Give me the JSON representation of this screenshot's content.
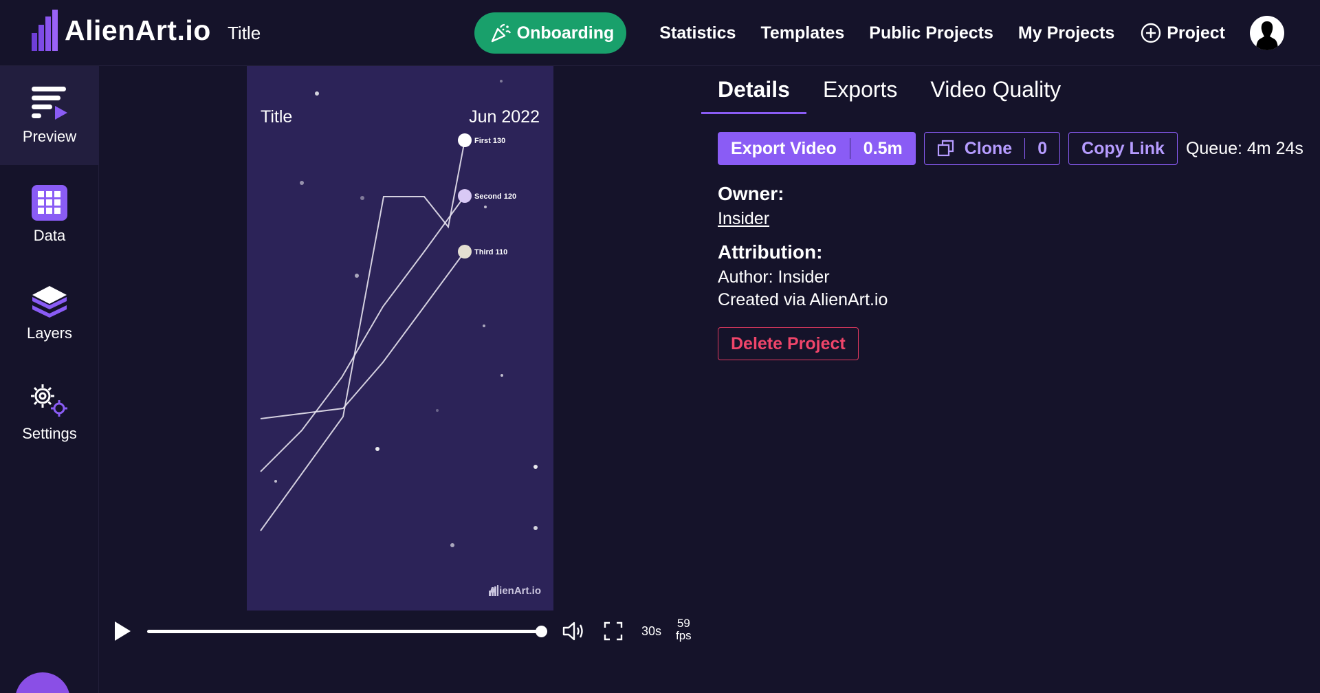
{
  "header": {
    "brand": "AlienArt.io",
    "project_title": "Title",
    "nav": {
      "onboarding": "Onboarding",
      "statistics": "Statistics",
      "templates": "Templates",
      "public_projects": "Public Projects",
      "my_projects": "My Projects",
      "new_project": "Project"
    }
  },
  "sidebar": {
    "items": [
      {
        "label": "Preview",
        "icon": "preview-icon"
      },
      {
        "label": "Data",
        "icon": "grid-icon"
      },
      {
        "label": "Layers",
        "icon": "layers-icon"
      },
      {
        "label": "Settings",
        "icon": "gears-icon"
      }
    ]
  },
  "preview": {
    "title": "Title",
    "date": "Jun 2022",
    "watermark": "AlienArt.io",
    "background": "#2c2358",
    "chart_data": {
      "type": "line",
      "series": [
        {
          "name": "First",
          "end_value": 130,
          "label": "First 130",
          "dot_color": "#ffffff"
        },
        {
          "name": "Second",
          "end_value": 120,
          "label": "Second 120",
          "dot_color": "#d9c9f5"
        },
        {
          "name": "Third",
          "end_value": 110,
          "label": "Third 110",
          "dot_color": "#e4dfd2"
        }
      ]
    }
  },
  "player": {
    "duration": "30s",
    "fps_value": "59",
    "fps_unit": "fps",
    "progress": 1.0
  },
  "details": {
    "tabs": [
      "Details",
      "Exports",
      "Video Quality"
    ],
    "active_tab": "Details",
    "export_label": "Export Video",
    "export_cost": "0.5m",
    "clone_label": "Clone",
    "clone_count": "0",
    "copy_link_label": "Copy Link",
    "queue": "Queue: 4m 24s",
    "owner_heading": "Owner:",
    "owner_name": "Insider",
    "attribution_heading": "Attribution:",
    "attribution_author": "Author: Insider",
    "attribution_created": "Created via AlienArt.io",
    "delete_label": "Delete Project"
  },
  "colors": {
    "accent": "#8a5cf5",
    "onboarding": "#19a06b",
    "danger": "#e0395f",
    "background": "#15132a"
  }
}
